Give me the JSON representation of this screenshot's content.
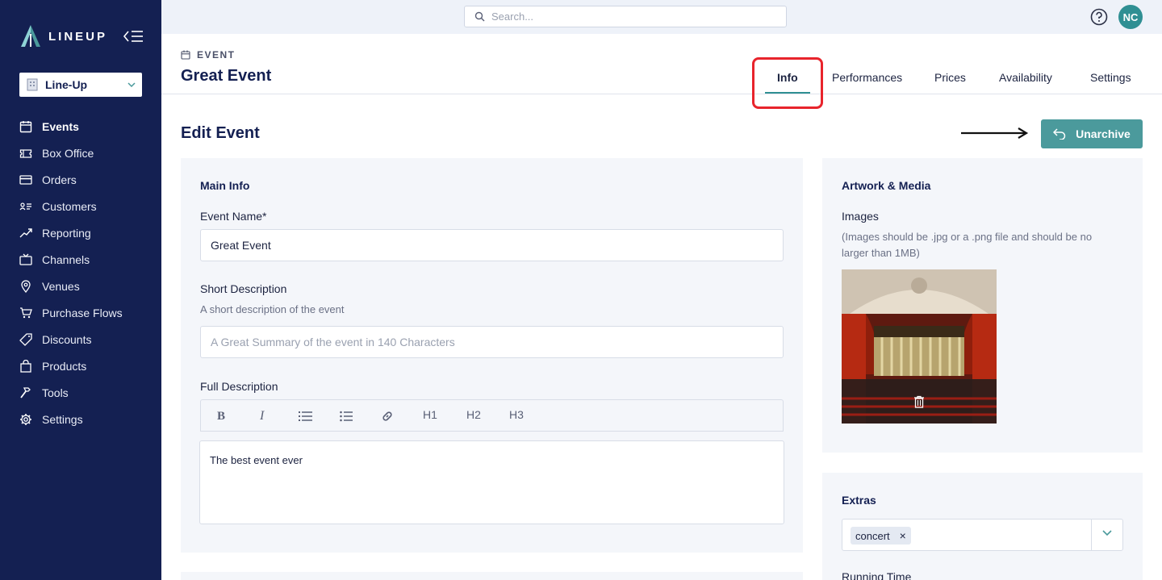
{
  "sidebar": {
    "brand": "LINEUP",
    "org_selector": "Line-Up",
    "items": [
      {
        "label": "Events",
        "icon": "calendar-icon",
        "active": true
      },
      {
        "label": "Box Office",
        "icon": "ticket-icon"
      },
      {
        "label": "Orders",
        "icon": "credit-card-icon"
      },
      {
        "label": "Customers",
        "icon": "contacts-icon"
      },
      {
        "label": "Reporting",
        "icon": "trend-chart-icon"
      },
      {
        "label": "Channels",
        "icon": "tv-icon"
      },
      {
        "label": "Venues",
        "icon": "location-pin-icon"
      },
      {
        "label": "Purchase Flows",
        "icon": "cart-icon"
      },
      {
        "label": "Discounts",
        "icon": "tag-icon"
      },
      {
        "label": "Products",
        "icon": "shopping-bag-icon"
      },
      {
        "label": "Tools",
        "icon": "hammer-icon"
      },
      {
        "label": "Settings",
        "icon": "gear-icon"
      }
    ]
  },
  "topbar": {
    "search_placeholder": "Search...",
    "avatar_initials": "NC"
  },
  "header": {
    "breadcrumb": "EVENT",
    "title": "Great Event",
    "tabs": [
      {
        "label": "Info",
        "active": true
      },
      {
        "label": "Performances"
      },
      {
        "label": "Prices"
      },
      {
        "label": "Availability"
      },
      {
        "label": "Settings"
      }
    ]
  },
  "content": {
    "title": "Edit Event",
    "unarchive_label": "Unarchive"
  },
  "main_info": {
    "title": "Main Info",
    "event_name_label": "Event Name*",
    "event_name_value": "Great Event",
    "short_desc_label": "Short Description",
    "short_desc_hint": "A short description of the event",
    "short_desc_placeholder": "A Great Summary of the event in 140 Characters",
    "full_desc_label": "Full Description",
    "toolbar": {
      "h1": "H1",
      "h2": "H2",
      "h3": "H3"
    },
    "full_desc_value": "The best event ever"
  },
  "artwork": {
    "title": "Artwork & Media",
    "images_label": "Images",
    "images_hint": "(Images should be .jpg or a .png file and should be no larger than 1MB)"
  },
  "extras": {
    "title": "Extras",
    "tag": "concert",
    "running_time_label": "Running Time"
  },
  "colors": {
    "sidebar": "#142052",
    "accent": "#4b9a9c",
    "highlight": "#e8242c"
  }
}
